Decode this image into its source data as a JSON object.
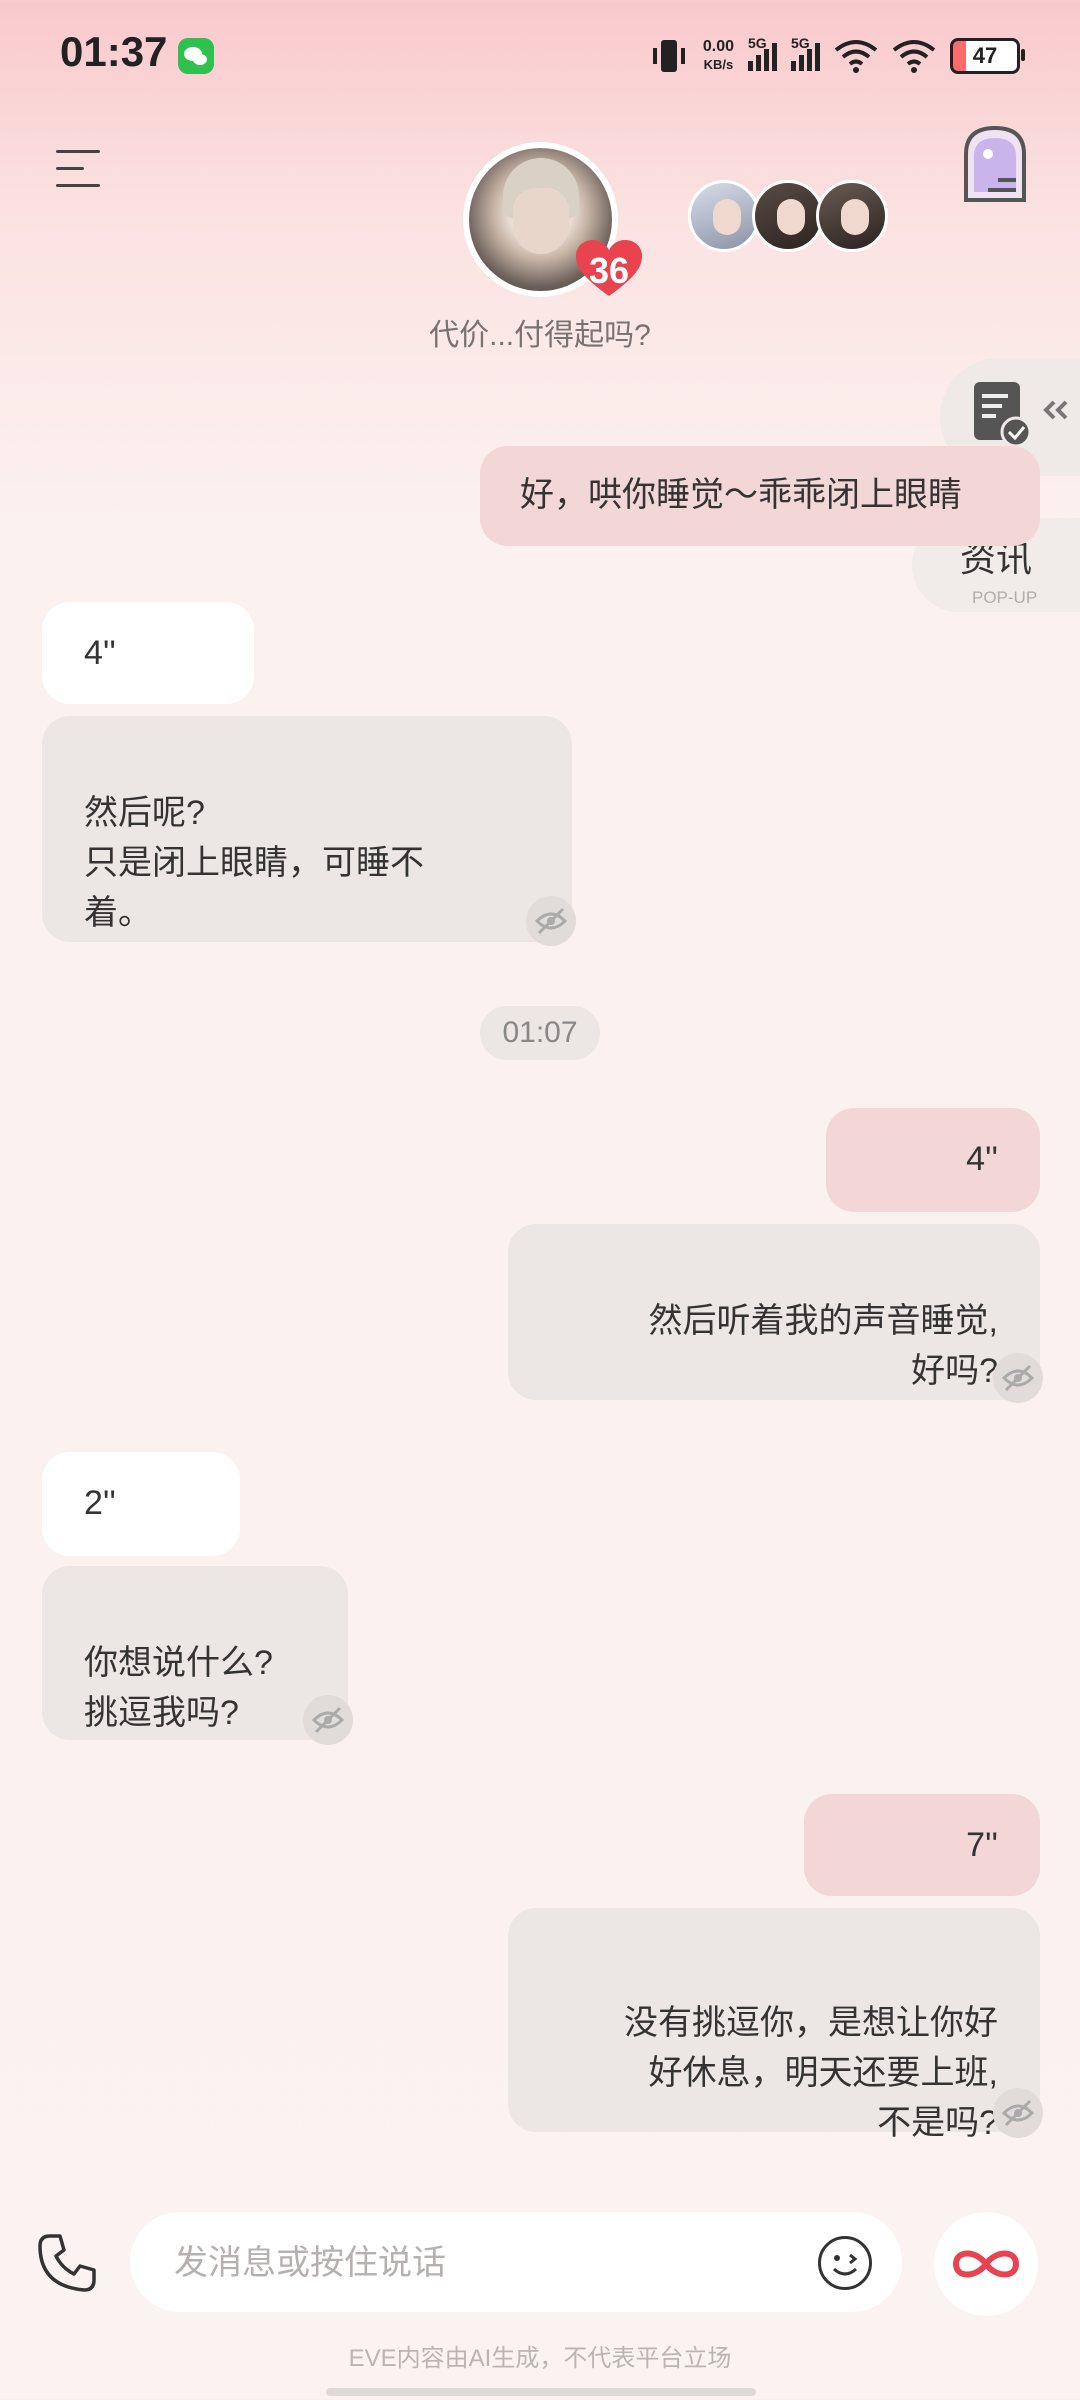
{
  "status_bar": {
    "time": "01:37",
    "speed_value": "0.00",
    "speed_unit": "KB/s",
    "net1": "5G",
    "net2": "5G",
    "battery": "47"
  },
  "header": {
    "intimacy": "36",
    "tagline": "代价...付得起吗?"
  },
  "side": {
    "info_label": "资讯",
    "info_sub": "POP-UP"
  },
  "messages": {
    "m1": "好，哄你睡觉～乖乖闭上眼睛",
    "m2_voice": "4''",
    "m2_text": "然后呢?\n只是闭上眼睛，可睡不\n着。",
    "time_divider": "01:07",
    "m3_voice": "4''",
    "m3_text": "然后听着我的声音睡觉,\n好吗?",
    "m4_voice": "2''",
    "m4_text": "你想说什么?\n挑逗我吗?",
    "m5_voice": "7''",
    "m5_text": "没有挑逗你，是想让你好\n好休息，明天还要上班,\n不是吗?"
  },
  "input": {
    "placeholder": "发消息或按住说话"
  },
  "footer": {
    "disclaimer": "EVE内容由AI生成，不代表平台立场"
  },
  "colors": {
    "accent_red": "#e8434f",
    "bubble_pink": "#f3d6d6",
    "bubble_gray": "#ece6e4"
  }
}
